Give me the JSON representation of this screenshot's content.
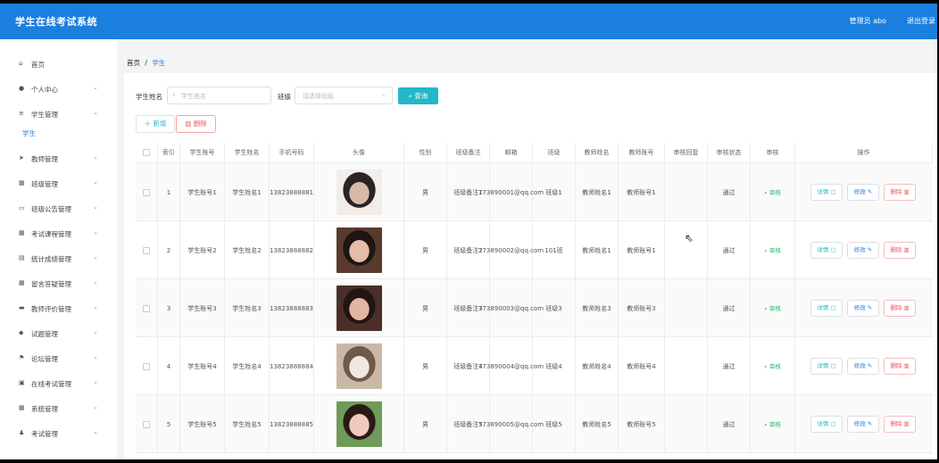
{
  "header": {
    "title": "学生在线考试系统",
    "user": "管理员 abo",
    "logout": "退出登录"
  },
  "sidebar": {
    "items": [
      {
        "label": "首页",
        "icon": "home-icon",
        "glyph": "⌂",
        "chev": ""
      },
      {
        "label": "个人中心",
        "icon": "user-icon",
        "glyph": "●",
        "chev": "⌄"
      },
      {
        "label": "学生管理",
        "icon": "list-icon",
        "glyph": "≡",
        "chev": "⌄"
      },
      {
        "label": "教师管理",
        "icon": "send-icon",
        "glyph": "➤",
        "chev": "⌄"
      },
      {
        "label": "班级管理",
        "icon": "grid-icon",
        "glyph": "▦",
        "chev": "⌄"
      },
      {
        "label": "班级公告管理",
        "icon": "board-icon",
        "glyph": "▭",
        "chev": "⌄"
      },
      {
        "label": "考试课程管理",
        "icon": "grid-icon",
        "glyph": "▦",
        "chev": "⌄"
      },
      {
        "label": "统计成绩管理",
        "icon": "chart-icon",
        "glyph": "▤",
        "chev": "⌄"
      },
      {
        "label": "留言答疑管理",
        "icon": "grid-icon",
        "glyph": "▦",
        "chev": "⌄"
      },
      {
        "label": "教师评价管理",
        "icon": "camera-icon",
        "glyph": "▬",
        "chev": "⌄"
      },
      {
        "label": "试题管理",
        "icon": "cup-icon",
        "glyph": "◆",
        "chev": "⌄"
      },
      {
        "label": "论坛管理",
        "icon": "flag-icon",
        "glyph": "⚑",
        "chev": "⌄"
      },
      {
        "label": "在线考试管理",
        "icon": "doc-icon",
        "glyph": "▣",
        "chev": "⌄"
      },
      {
        "label": "系统管理",
        "icon": "grid-icon",
        "glyph": "▦",
        "chev": "⌄"
      },
      {
        "label": "考试管理",
        "icon": "person-icon",
        "glyph": "♟",
        "chev": "⌄"
      }
    ],
    "sub_active": "学生"
  },
  "breadcrumb": {
    "home": "首页",
    "sep": "/",
    "current": "学生"
  },
  "search": {
    "name_label": "学生姓名",
    "name_placeholder": "学生姓名",
    "class_label": "班级",
    "class_placeholder": "请选择班级",
    "search_button": "查询"
  },
  "actions": {
    "add": "＋ 新增",
    "delete": "删除"
  },
  "table": {
    "columns": [
      "索引",
      "学生账号",
      "学生姓名",
      "手机号码",
      "头像",
      "性别",
      "班级备注",
      "邮箱",
      "班级",
      "教师姓名",
      "教师账号",
      "审核回复",
      "审核状态",
      "审核",
      "操作"
    ],
    "rows": [
      {
        "idx": "1",
        "account": "学生账号1",
        "name": "学生姓名1",
        "phone": "13823888881",
        "gender": "男",
        "note": "班级备注1",
        "email": "773890001@qq.com",
        "class": "班级1",
        "tname": "教师姓名1",
        "taccount": "教师账号1",
        "reply": "",
        "status": "通过",
        "avatar": [
          "#f2ede8",
          "#2b2424",
          "#d9b9a6"
        ]
      },
      {
        "idx": "2",
        "account": "学生账号2",
        "name": "学生姓名2",
        "phone": "13823888882",
        "gender": "男",
        "note": "班级备注2",
        "email": "773890002@qq.com",
        "class": "101班",
        "tname": "教师姓名1",
        "taccount": "教师账号1",
        "reply": "",
        "status": "通过",
        "avatar": [
          "#5a3a2f",
          "#1e1514",
          "#e6bba7"
        ]
      },
      {
        "idx": "3",
        "account": "学生账号3",
        "name": "学生姓名3",
        "phone": "13823888883",
        "gender": "男",
        "note": "班级备注3",
        "email": "773890003@qq.com",
        "class": "班级3",
        "tname": "教师姓名3",
        "taccount": "教师账号3",
        "reply": "",
        "status": "通过",
        "avatar": [
          "#4a2f28",
          "#221614",
          "#e3b5a3"
        ]
      },
      {
        "idx": "4",
        "account": "学生账号4",
        "name": "学生姓名4",
        "phone": "13823888884",
        "gender": "男",
        "note": "班级备注4",
        "email": "773890004@qq.com",
        "class": "班级4",
        "tname": "教师姓名4",
        "taccount": "教师账号4",
        "reply": "",
        "status": "通过",
        "avatar": [
          "#c9b8a6",
          "#6e5a4a",
          "#f0e8df"
        ]
      },
      {
        "idx": "5",
        "account": "学生账号5",
        "name": "学生姓名5",
        "phone": "13823888885",
        "gender": "男",
        "note": "班级备注5",
        "email": "773890005@qq.com",
        "class": "班级5",
        "tname": "教师姓名5",
        "taccount": "教师账号5",
        "reply": "",
        "status": "通过",
        "avatar": [
          "#6e9a5a",
          "#2a1a16",
          "#f2c9bf"
        ]
      }
    ],
    "audit_label": "⌕ 审核",
    "view_label": "详情 ▢",
    "edit_label": "修改 ✎",
    "delete_label": "删除 ▥"
  }
}
